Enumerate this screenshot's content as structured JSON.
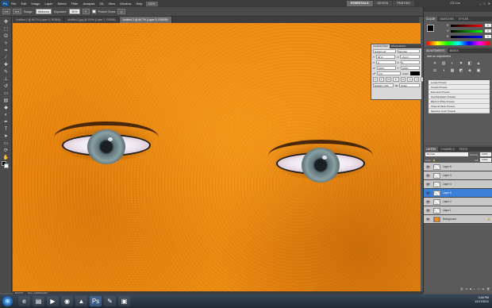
{
  "menubar": {
    "logo": "Ps",
    "items": [
      "File",
      "Edit",
      "Image",
      "Layer",
      "Select",
      "Filter",
      "Analysis",
      "3D",
      "View",
      "Window",
      "Help"
    ],
    "zoom_label": "100%",
    "workspaces": [
      "ESSENTIALS",
      "DESIGN",
      "PAINTING"
    ],
    "active_workspace": "ESSENTIALS",
    "cs_live": "CS Live",
    "window_buttons": [
      "–",
      "□",
      "✕"
    ]
  },
  "options": {
    "range_label": "Range:",
    "range_value": "Midtones",
    "exposure_label": "Exposure:",
    "exposure_value": "50%",
    "protect_tones": "Protect Tones"
  },
  "tabs": [
    {
      "label": "Untitled-1 @ 66.7% (Layer 5, RGB/8)",
      "active": false
    },
    {
      "label": "Untitled-2.jpg @ 100% (Layer 1, RGB/8)",
      "active": false
    },
    {
      "label": "Untitled-3 @ 66.7% (Layer 5, RGB/8)*",
      "active": true
    }
  ],
  "character_panel": {
    "tabs": [
      "CHARACTER",
      "PARAGRAPH"
    ],
    "font": "Garamond",
    "style": "Regular",
    "size": "30 pt",
    "leading": "(Auto)",
    "tracking": "0",
    "kerning": "0",
    "vscale": "100%",
    "hscale": "100%",
    "baseline": "0 pt",
    "color_label": "Color:",
    "language": "English: USA",
    "aa": "Sharp"
  },
  "color_panel": {
    "tabs": [
      "COLOR",
      "SWATCHES",
      "STYLES"
    ],
    "r": "0",
    "g": "0",
    "b": "0",
    "fg_color": "#000000"
  },
  "adjustments": {
    "tabs": [
      "ADJUSTMENTS",
      "MASKS"
    ],
    "header": "Add an adjustment",
    "icons": [
      "☀",
      "▥",
      "◐",
      "▼",
      "◧",
      "▲",
      "⚖",
      "◑",
      "▦",
      "◩",
      "◈",
      "▣"
    ],
    "presets": [
      "Levels Presets",
      "Curves Presets",
      "Exposure Presets",
      "Hue/Saturation Presets",
      "Black & White Presets",
      "Channel Mixer Presets",
      "Selective Color Presets"
    ]
  },
  "layers_panel": {
    "tabs": [
      "LAYERS",
      "CHANNELS",
      "PATHS"
    ],
    "blend_mode": "Normal",
    "opacity_label": "Opacity:",
    "opacity": "100%",
    "lock_label": "Lock:",
    "fill_label": "Fill:",
    "fill": "100%",
    "layers": [
      {
        "name": "Layer 6",
        "selected": false,
        "bg": false
      },
      {
        "name": "Layer 3",
        "selected": false,
        "bg": false
      },
      {
        "name": "Layer 4",
        "selected": false,
        "bg": false
      },
      {
        "name": "Layer 5",
        "selected": true,
        "bg": false
      },
      {
        "name": "Layer 2",
        "selected": false,
        "bg": false
      },
      {
        "name": "Layer 1",
        "selected": false,
        "bg": false
      },
      {
        "name": "Background",
        "selected": false,
        "bg": true
      }
    ]
  },
  "status": {
    "zoom": "66.67%",
    "doc": "Doc: 1.81M/14.6M"
  },
  "taskbar": {
    "apps": [
      "ie-icon",
      "folder-icon",
      "media-icon",
      "chrome-icon",
      "vlc-icon",
      "photoshop-icon",
      "paint-icon",
      "app-icon"
    ],
    "time": "3:48 PM",
    "date": "12/17/2011"
  }
}
